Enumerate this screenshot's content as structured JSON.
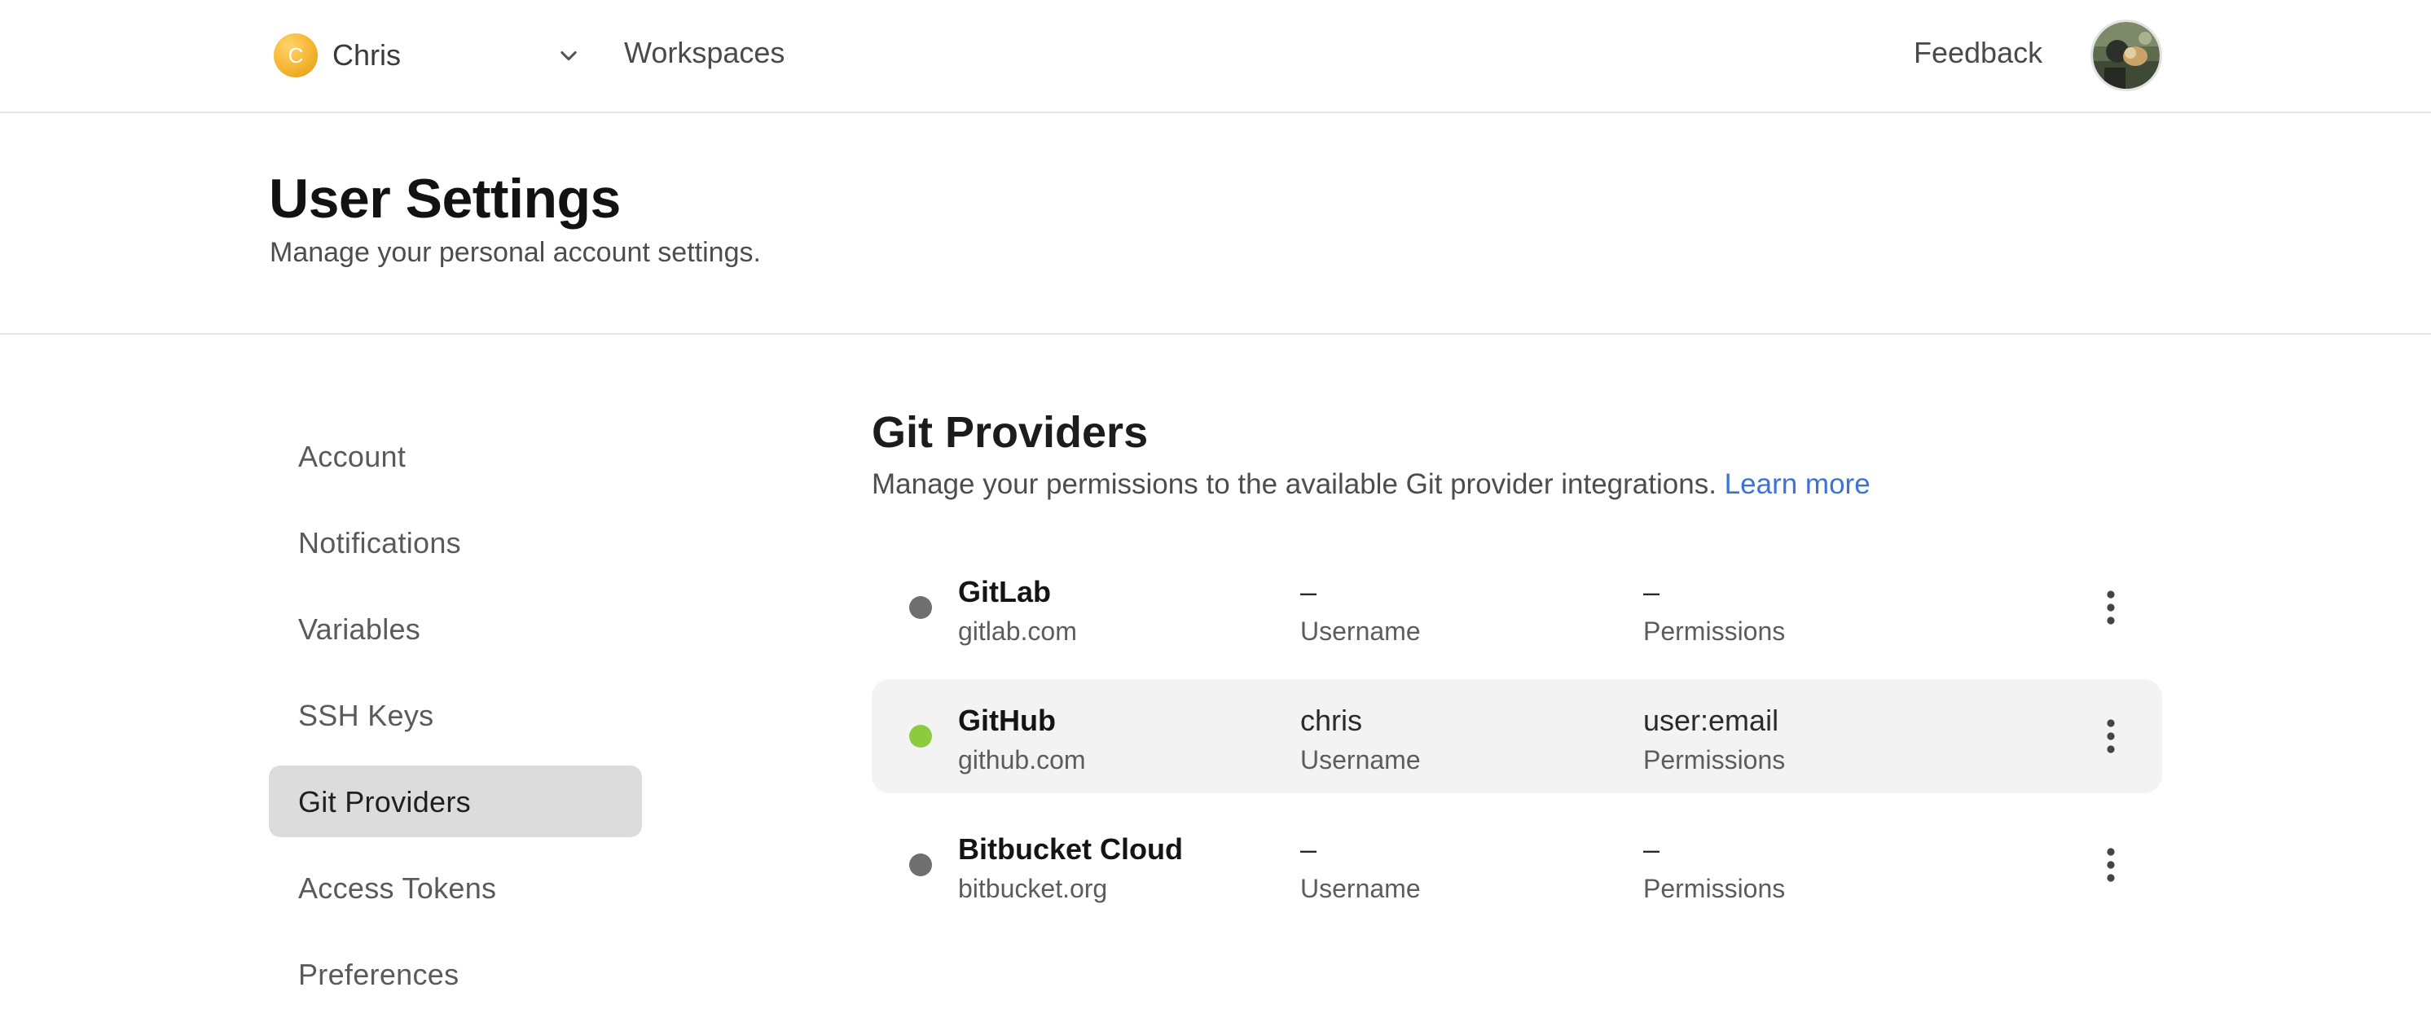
{
  "topbar": {
    "org": {
      "initial": "C",
      "name": "Chris"
    },
    "nav_workspaces": "Workspaces",
    "nav_feedback": "Feedback"
  },
  "header": {
    "title": "User Settings",
    "subtitle": "Manage your personal account settings."
  },
  "sidebar": {
    "items": [
      {
        "label": "Account",
        "active": false
      },
      {
        "label": "Notifications",
        "active": false
      },
      {
        "label": "Variables",
        "active": false
      },
      {
        "label": "SSH Keys",
        "active": false
      },
      {
        "label": "Git Providers",
        "active": true
      },
      {
        "label": "Access Tokens",
        "active": false
      },
      {
        "label": "Preferences",
        "active": false
      }
    ]
  },
  "main": {
    "title": "Git Providers",
    "description": "Manage your permissions to the available Git provider integrations.",
    "learn_more": "Learn more",
    "providers": [
      {
        "name": "GitLab",
        "host": "gitlab.com",
        "username": "–",
        "username_label": "Username",
        "permissions": "–",
        "permissions_label": "Permissions",
        "connected": false
      },
      {
        "name": "GitHub",
        "host": "github.com",
        "username": "chris",
        "username_label": "Username",
        "permissions": "user:email",
        "permissions_label": "Permissions",
        "connected": true
      },
      {
        "name": "Bitbucket Cloud",
        "host": "bitbucket.org",
        "username": "–",
        "username_label": "Username",
        "permissions": "–",
        "permissions_label": "Permissions",
        "connected": false
      }
    ]
  },
  "colors": {
    "accent_link": "#3b73d6",
    "status_connected": "#8ccb3c",
    "status_disconnected": "#6f6f6f",
    "org_avatar": "#f5b530",
    "active_sidebar_bg": "#dcdcdc",
    "connected_row_bg": "#f3f3f3"
  },
  "icons": {
    "org_dropdown": "chevron-down-icon",
    "row_menu": "kebab-menu-icon",
    "user_avatar": "user-avatar-photo"
  }
}
